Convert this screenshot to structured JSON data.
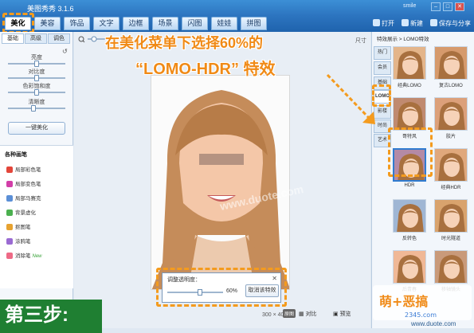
{
  "app": {
    "title": "美图秀秀 3.1.6",
    "user": "smile"
  },
  "menu": {
    "tabs": [
      {
        "label": "美化"
      },
      {
        "label": "美容"
      },
      {
        "label": "饰品"
      },
      {
        "label": "文字"
      },
      {
        "label": "边框"
      },
      {
        "label": "场景"
      },
      {
        "label": "闪图"
      },
      {
        "label": "娃娃"
      },
      {
        "label": "拼图"
      }
    ],
    "open": "打开",
    "new": "新建",
    "save_share": "保存与分享"
  },
  "left": {
    "sub_tabs": [
      "基础",
      "高级",
      "调色"
    ],
    "sliders": [
      {
        "label": "亮度",
        "value": 0.5
      },
      {
        "label": "对比度",
        "value": 0.5
      },
      {
        "label": "色彩饱和度",
        "value": 0.5
      },
      {
        "label": "清晰度",
        "value": 0.45
      }
    ],
    "one_click": "一键美化",
    "brushes_title": "各种画笔",
    "brushes": [
      {
        "label": "局部彩色笔",
        "color": "#e3463a"
      },
      {
        "label": "局部变色笔",
        "color": "#d23ea8"
      },
      {
        "label": "局部马赛克",
        "color": "#5b8fd6"
      },
      {
        "label": "背景虚化",
        "color": "#4bb04f"
      },
      {
        "label": "抠图笔",
        "color": "#e7a230"
      },
      {
        "label": "涂鸦笔",
        "color": "#9a6ad2"
      },
      {
        "label": "消除笔",
        "color": "#ee6a86",
        "badge": "New"
      }
    ]
  },
  "canvas": {
    "size_label": "尺寸",
    "dimensions": "300 × 400",
    "full_label": "原图",
    "compare": "对比",
    "preview": "预览"
  },
  "opacity_dialog": {
    "title": "调整透明度：",
    "value": "60%",
    "cancel": "取消该特效",
    "close": "✕",
    "level": 0.6
  },
  "right": {
    "breadcrumb": "特效展示 > LOMO特效",
    "categories": [
      "热门",
      "会员",
      "基础",
      "LOMO",
      "影楼",
      "时尚",
      "艺术"
    ],
    "thumbs": [
      {
        "label": "经典LOMO"
      },
      {
        "label": "复古LOMO"
      },
      {
        "label": "哥特风"
      },
      {
        "label": "胶片"
      },
      {
        "label": "HDR"
      },
      {
        "label": "经典HDR"
      },
      {
        "label": "反转色"
      },
      {
        "label": "时光隧道"
      },
      {
        "label": "后青春"
      },
      {
        "label": "移轴镜头"
      }
    ]
  },
  "overlay": {
    "caption_line1": "在美化菜单下选择60%的",
    "caption_line2": "“LOMO-HDR” 特效",
    "step": "第三步:",
    "watermark": "www.duote.com",
    "logo_text": "萌+恶搞",
    "logo_sub": "2345.com",
    "site_url": "www.duote.com"
  },
  "colors": {
    "accent_orange": "#f08a16",
    "menu_blue": "#2c74bf",
    "step_green": "#1f7f32"
  }
}
